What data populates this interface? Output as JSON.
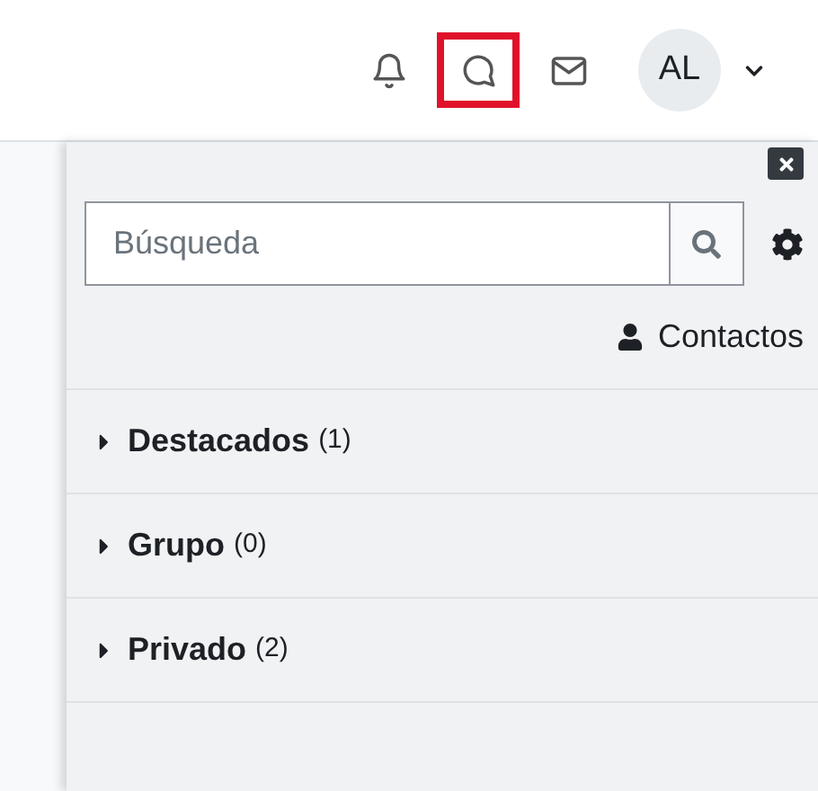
{
  "header": {
    "icons": [
      {
        "kind": "bell",
        "highlighted": false
      },
      {
        "kind": "chat",
        "highlighted": true
      },
      {
        "kind": "mail",
        "highlighted": false
      }
    ],
    "avatar": "AL"
  },
  "drawer": {
    "search": {
      "placeholder": "Búsqueda"
    },
    "contacts_link": "Contactos",
    "sections": [
      {
        "title": "Destacados",
        "count": "(1)",
        "expanded": false
      },
      {
        "title": "Grupo",
        "count": "(0)",
        "expanded": false
      },
      {
        "title": "Privado",
        "count": "(2)",
        "expanded": false
      }
    ]
  }
}
